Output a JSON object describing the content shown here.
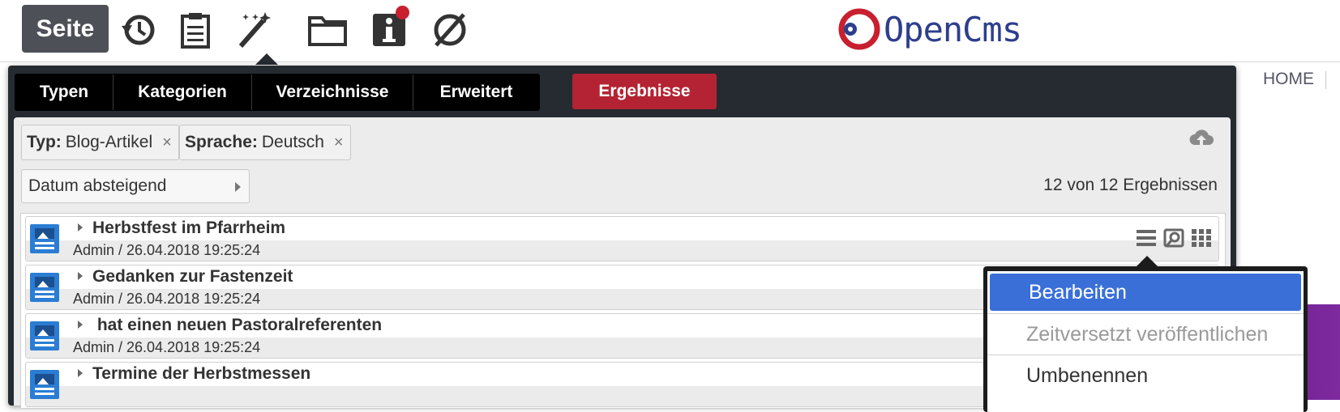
{
  "toolbar": {
    "page_button": "Seite",
    "icons": [
      "history-icon",
      "clipboard-icon",
      "magic-wand-icon",
      "folder-icon",
      "info-icon",
      "hide-icon"
    ]
  },
  "logo": {
    "text": "OpenCms",
    "ring_color": "#c8202f",
    "text_color": "#2d3e8c"
  },
  "background_page": {
    "nav_home": "HOME"
  },
  "gallery": {
    "tabs": [
      "Typen",
      "Kategorien",
      "Verzeichnisse",
      "Erweitert"
    ],
    "results_tab": "Ergebnisse",
    "filters": [
      {
        "label": "Typ:",
        "value": "Blog-Artikel"
      },
      {
        "label": "Sprache:",
        "value": "Deutsch"
      }
    ],
    "remove_symbol": "×",
    "sort": {
      "value": "Datum absteigend"
    },
    "result_count": "12 von 12 Ergebnissen",
    "results": [
      {
        "title": "Herbstfest im Pfarrheim",
        "meta": "Admin / 26.04.2018 19:25:24"
      },
      {
        "title": "Gedanken zur Fastenzeit",
        "meta": "Admin / 26.04.2018 19:25:24"
      },
      {
        "title": " hat einen neuen Pastoralreferenten",
        "meta": "Admin / 26.04.2018 19:25:24"
      },
      {
        "title": "Termine der Herbstmessen",
        "meta": ""
      }
    ],
    "row_action_icons": [
      "menu-icon",
      "preview-icon",
      "grid-icon"
    ]
  },
  "context_menu": {
    "items": [
      {
        "label": "Bearbeiten",
        "state": "active"
      },
      {
        "label": "Zeitversetzt veröffentlichen",
        "state": "disabled"
      },
      {
        "label": "Umbenennen",
        "state": "normal"
      }
    ]
  },
  "colors": {
    "accent_red": "#b32333",
    "highlight_blue": "#3a6fd8",
    "dark_panel": "#262a31",
    "purple_bg": "#6a1c8a"
  }
}
